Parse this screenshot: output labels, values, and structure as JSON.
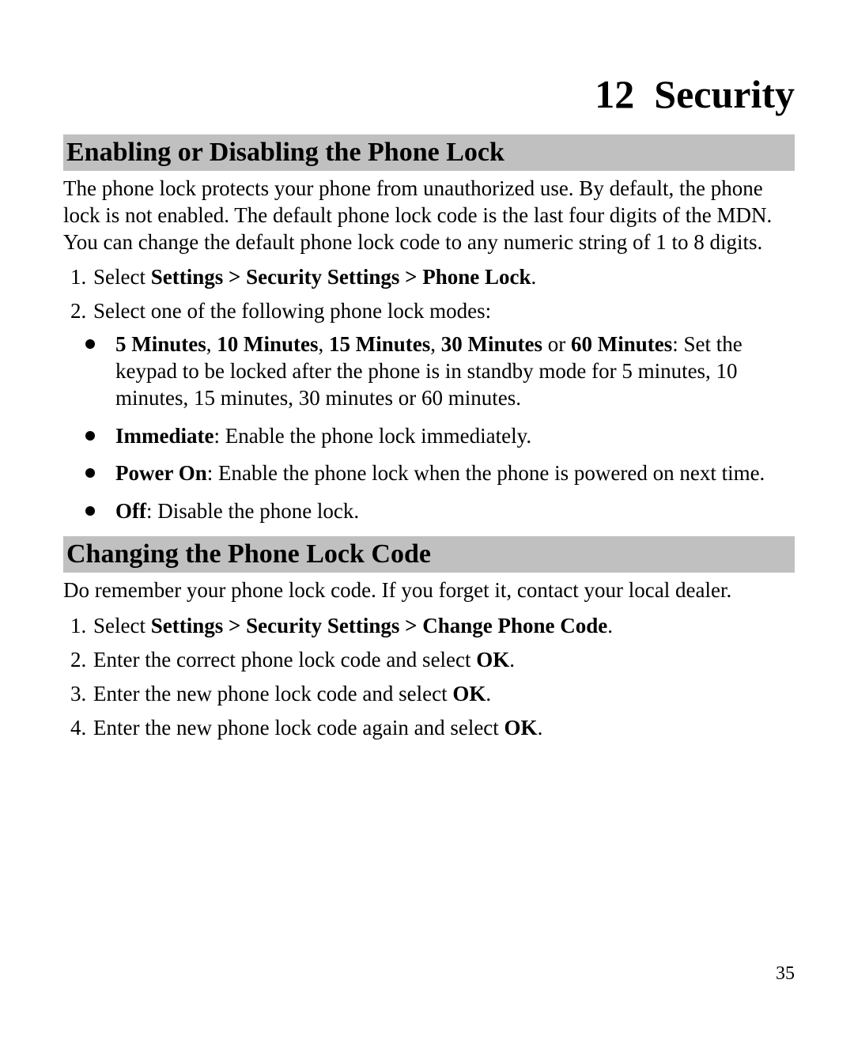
{
  "chapter": {
    "number": "12",
    "title": "Security"
  },
  "section1": {
    "heading": "Enabling or Disabling the Phone Lock",
    "intro": "The phone lock protects your phone from unauthorized use. By default, the phone lock is not enabled. The default phone lock code is the last four digits of the MDN. You can change the default phone lock code to any numeric string of 1 to 8 digits.",
    "step1_prefix": "Select ",
    "step1_bold": "Settings > Security Settings > Phone Lock",
    "step1_suffix": ".",
    "step2": "Select one of the following phone lock modes:",
    "bullet1_b1": "5 Minutes",
    "bullet1_s1": ", ",
    "bullet1_b2": "10 Minutes",
    "bullet1_s2": ", ",
    "bullet1_b3": "15 Minutes",
    "bullet1_s3": ", ",
    "bullet1_b4": "30 Minutes",
    "bullet1_s4": " or ",
    "bullet1_b5": "60 Minutes",
    "bullet1_tail": ": Set the keypad to be locked after the phone is in standby mode for 5 minutes, 10 minutes, 15 minutes, 30 minutes or 60 minutes.",
    "bullet2_b": "Immediate",
    "bullet2_tail": ": Enable the phone lock immediately.",
    "bullet3_b": "Power On",
    "bullet3_tail": ": Enable the phone lock when the phone is powered on next time.",
    "bullet4_b": "Off",
    "bullet4_tail": ": Disable the phone lock."
  },
  "section2": {
    "heading": "Changing the Phone Lock Code",
    "intro": "Do remember your phone lock code. If you forget it, contact your local dealer.",
    "step1_prefix": "Select ",
    "step1_bold": "Settings > Security Settings > Change Phone Code",
    "step1_suffix": ".",
    "step2_prefix": "Enter the correct phone lock code and select ",
    "step2_bold": "OK",
    "step2_suffix": ".",
    "step3_prefix": "Enter the new phone lock code and select ",
    "step3_bold": "OK",
    "step3_suffix": ".",
    "step4_prefix": "Enter the new phone lock code again and select ",
    "step4_bold": "OK",
    "step4_suffix": "."
  },
  "page_number": "35"
}
